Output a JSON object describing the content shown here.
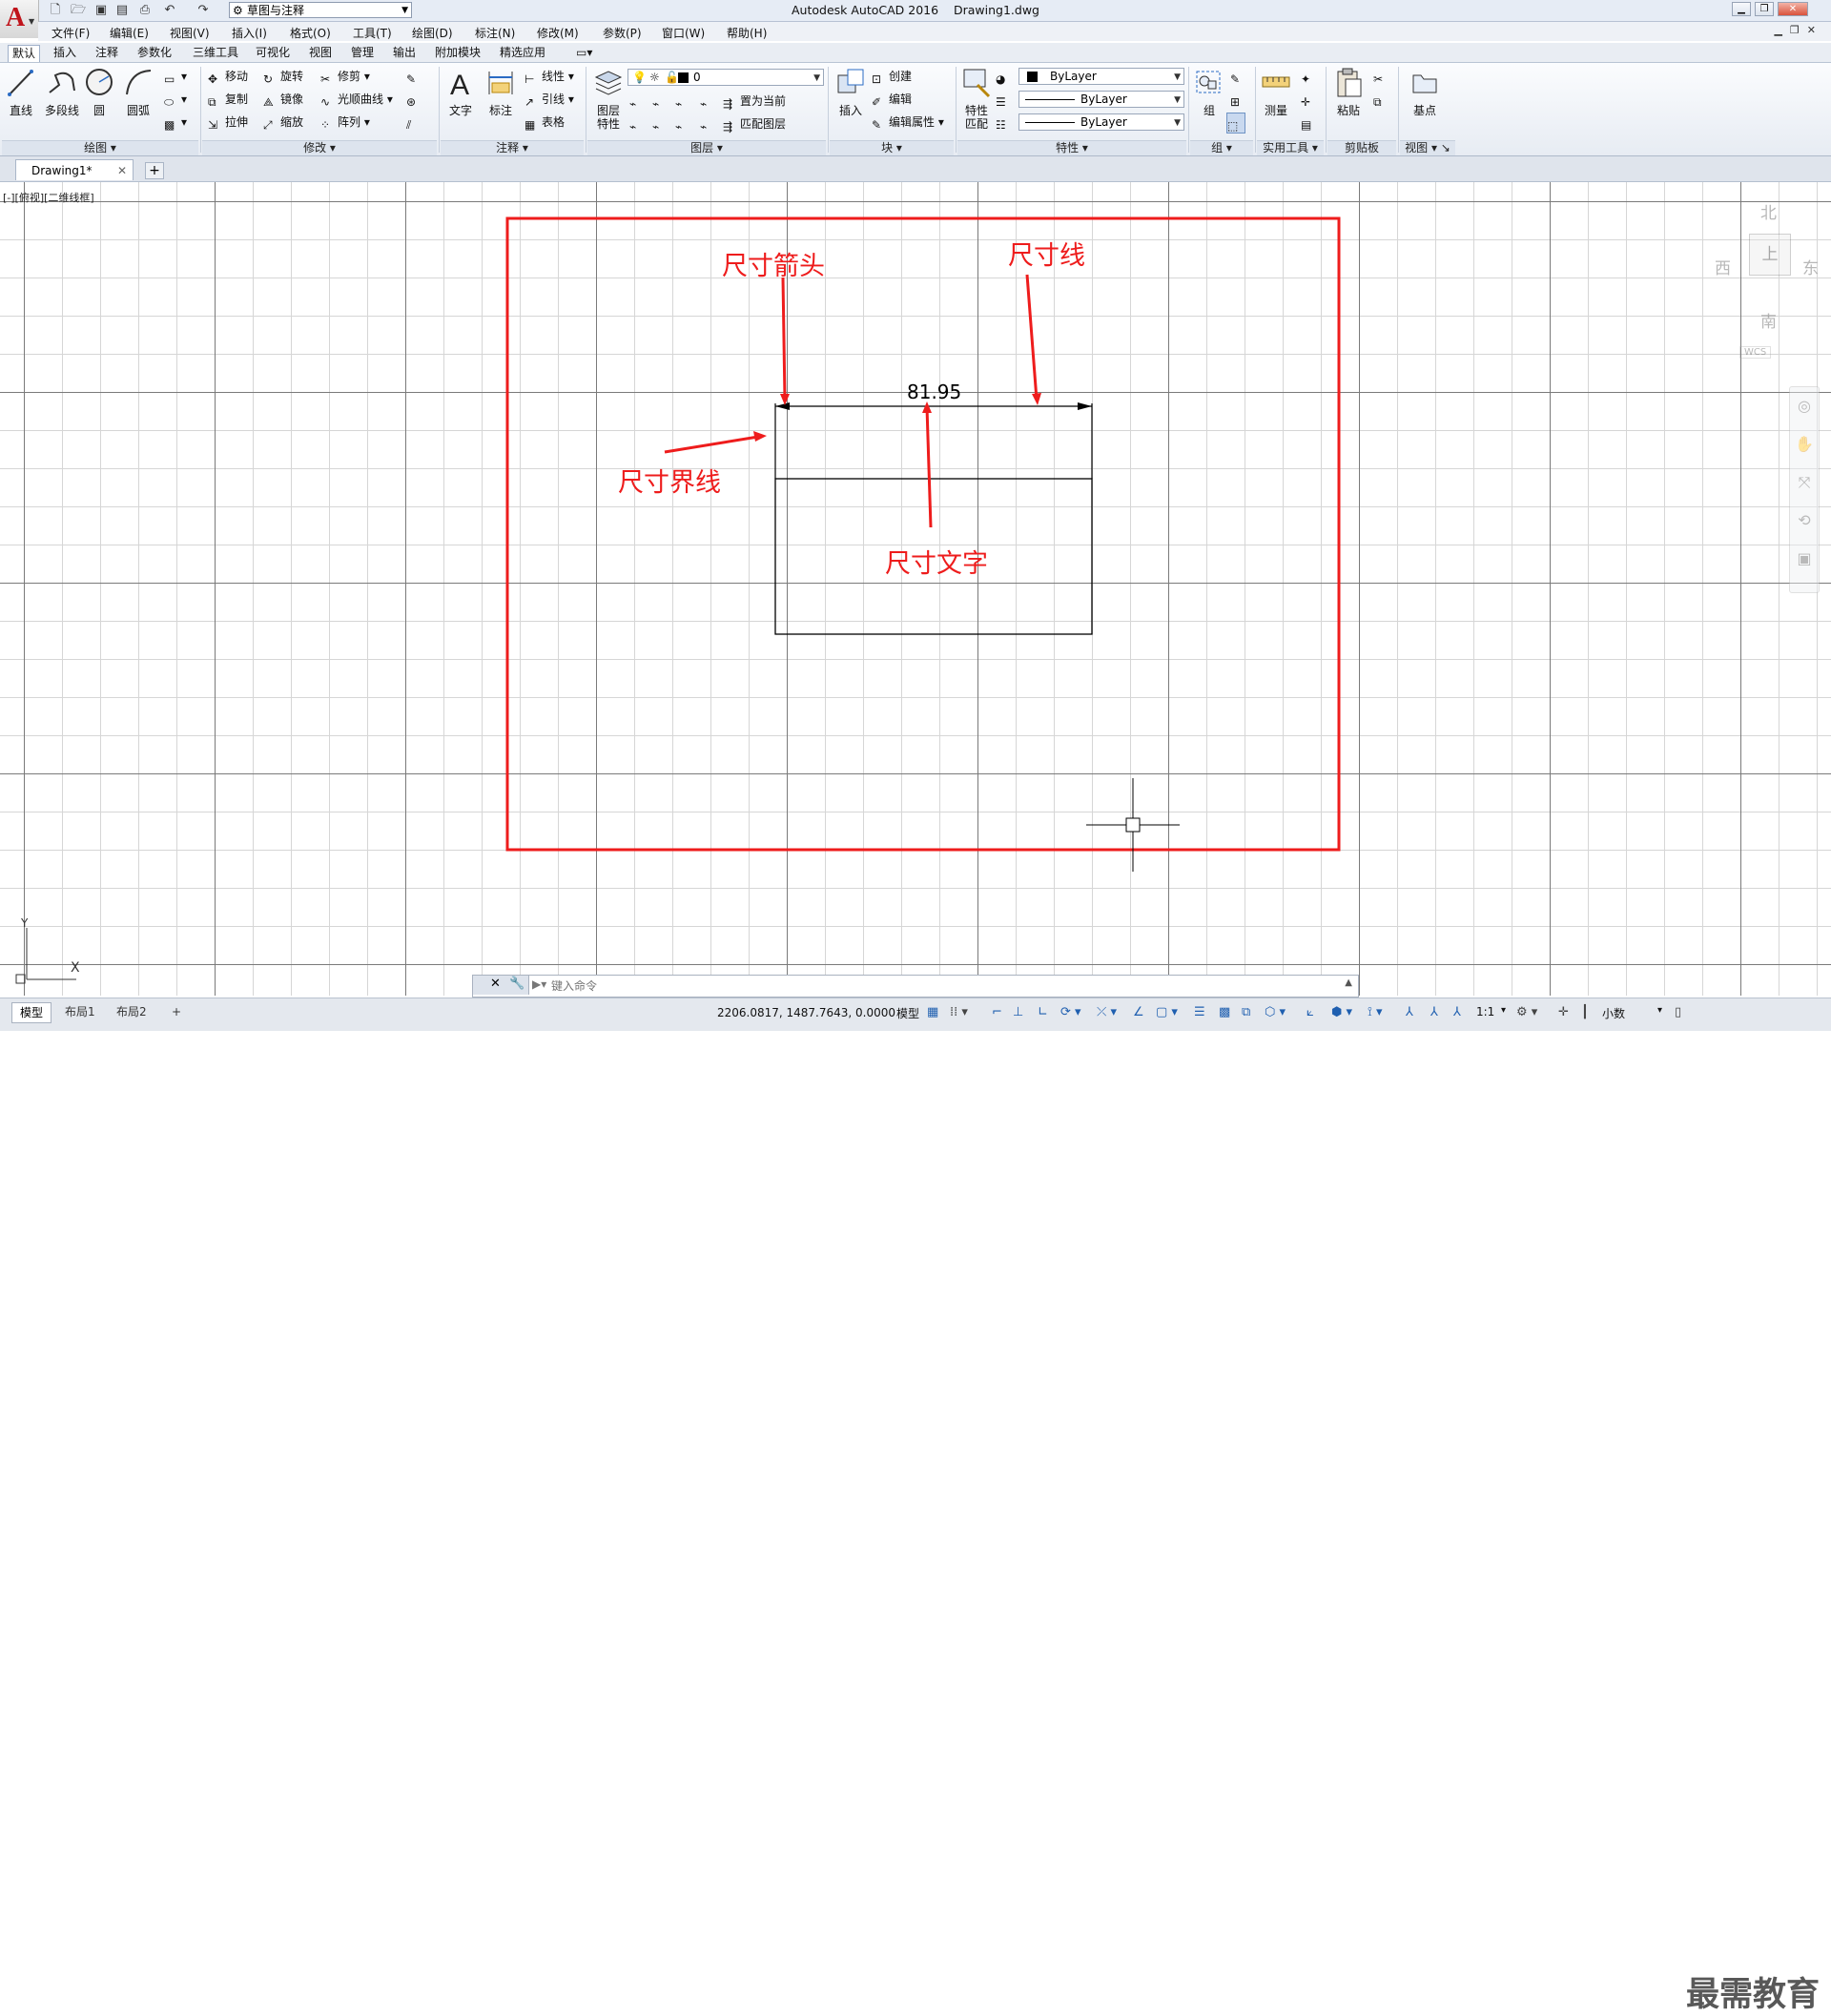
{
  "titlebar": {
    "workspace": "草图与注释",
    "app_name": "Autodesk AutoCAD 2016",
    "document": "Drawing1.dwg"
  },
  "menu": [
    "文件(F)",
    "编辑(E)",
    "视图(V)",
    "插入(I)",
    "格式(O)",
    "工具(T)",
    "绘图(D)",
    "标注(N)",
    "修改(M)",
    "参数(P)",
    "窗口(W)",
    "帮助(H)"
  ],
  "ribbon_tabs": [
    "默认",
    "插入",
    "注释",
    "参数化",
    "三维工具",
    "可视化",
    "视图",
    "管理",
    "输出",
    "附加模块",
    "精选应用"
  ],
  "ribbon": {
    "draw": {
      "title": "绘图",
      "line": "直线",
      "polyline": "多段线",
      "circle": "圆",
      "arc": "圆弧"
    },
    "modify": {
      "title": "修改",
      "move": "移动",
      "rotate": "旋转",
      "trim": "修剪",
      "copy": "复制",
      "mirror": "镜像",
      "fillet": "光顺曲线",
      "stretch": "拉伸",
      "scale": "缩放",
      "array": "阵列"
    },
    "annotation": {
      "title": "注释",
      "text": "文字",
      "dimension": "标注",
      "linear": "线性",
      "leader": "引线",
      "table": "表格"
    },
    "layers": {
      "title": "图层",
      "layer_props_1": "图层",
      "layer_props_2": "特性",
      "current_layer": "0",
      "set_current": "置为当前",
      "match_layer": "匹配图层"
    },
    "block": {
      "title": "块",
      "insert": "插入",
      "create": "创建",
      "edit": "编辑",
      "edit_attr": "编辑属性"
    },
    "properties": {
      "title": "特性",
      "match_1": "特性",
      "match_2": "匹配",
      "color": "ByLayer",
      "linetype": "ByLayer",
      "lineweight": "ByLayer"
    },
    "groups": {
      "title": "组",
      "group": "组"
    },
    "utilities": {
      "title": "实用工具",
      "measure": "测量"
    },
    "clipboard": {
      "title": "剪贴板",
      "paste": "粘贴"
    },
    "view": {
      "title": "视图",
      "base": "基点"
    }
  },
  "file_tab": {
    "name": "Drawing1*"
  },
  "canvas": {
    "viewport_label": "[-][俯视][二维线框]",
    "dimension_value": "81.95",
    "annotations": {
      "arrow": "尺寸箭头",
      "dim_line": "尺寸线",
      "ext_line": "尺寸界线",
      "dim_text": "尺寸文字"
    },
    "viewcube": {
      "north": "北",
      "south": "南",
      "east": "东",
      "west": "西",
      "face": "上",
      "wcs": "WCS"
    },
    "ucs": {
      "x": "X",
      "y": "Y"
    }
  },
  "command": {
    "placeholder": "键入命令"
  },
  "status": {
    "layouts": [
      "模型",
      "布局1",
      "布局2"
    ],
    "coords": "2206.0817, 1487.7643, 0.0000",
    "model": "模型",
    "scale": "1:1",
    "units": "小数"
  },
  "watermark": "最需教育",
  "colors": {
    "annotation_red": "#ee1c1c",
    "ribbon_bg": "#f0f3f8",
    "logo_red": "#c0141b"
  }
}
